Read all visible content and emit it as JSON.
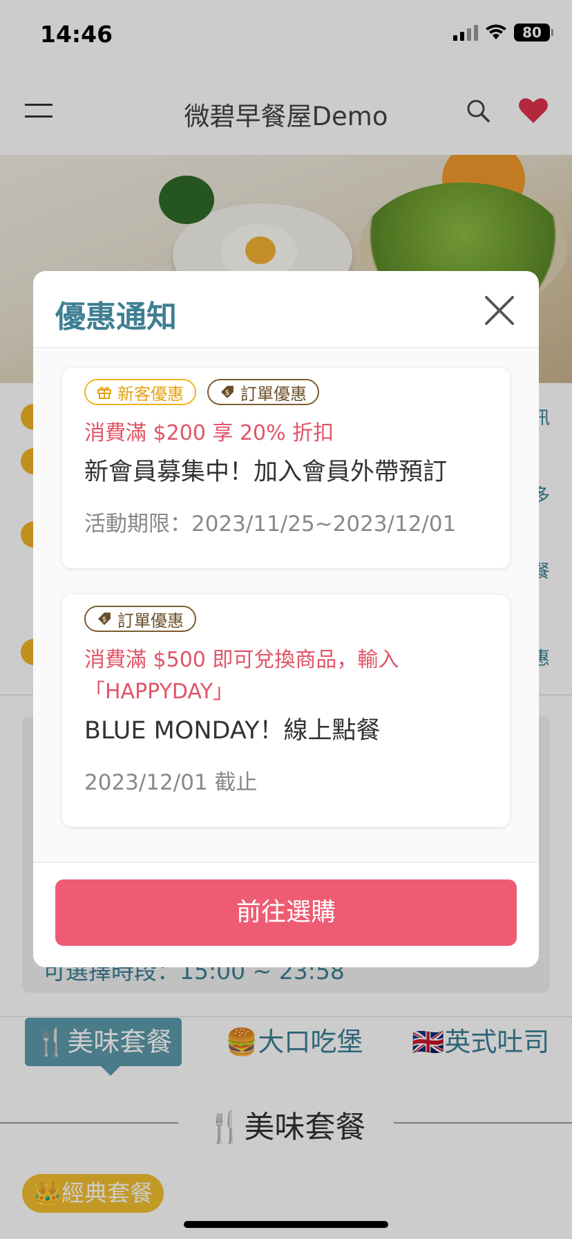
{
  "status_bar": {
    "time": "14:46",
    "battery": "80"
  },
  "header": {
    "title": "微碧早餐屋Demo"
  },
  "page": {
    "info_rows_right": [
      "訊",
      "多",
      "餐",
      "惠"
    ],
    "time_slot": "可選擇時段：15:00 ~ 23:58",
    "tabs": [
      {
        "label": "🍴美味套餐"
      },
      {
        "label": "🍔大口吃堡"
      },
      {
        "label": "🇬🇧英式吐司"
      }
    ],
    "section_title": "🍴美味套餐",
    "classic_chip": "👑經典套餐"
  },
  "modal": {
    "title": "優惠通知",
    "promos": [
      {
        "tags": [
          "新客優惠",
          "訂單優惠"
        ],
        "headline": "消費滿 $200 享 20% 折扣",
        "title": "新會員募集中！加入會員外帶預訂",
        "date": "活動期限：2023/11/25~2023/12/01"
      },
      {
        "tags": [
          "訂單優惠"
        ],
        "headline": "消費滿 $500 即可兌換商品，輸入「HAPPYDAY」",
        "title": "BLUE MONDAY！線上點餐",
        "date": "2023/12/01 截止"
      }
    ],
    "cta_label": "前往選購"
  },
  "colors": {
    "accent": "#3f7f93",
    "promo_red": "#e05466",
    "cta": "#ee5c73",
    "tag_yellow": "#f1b31c",
    "tag_brown": "#7a5b2f"
  }
}
